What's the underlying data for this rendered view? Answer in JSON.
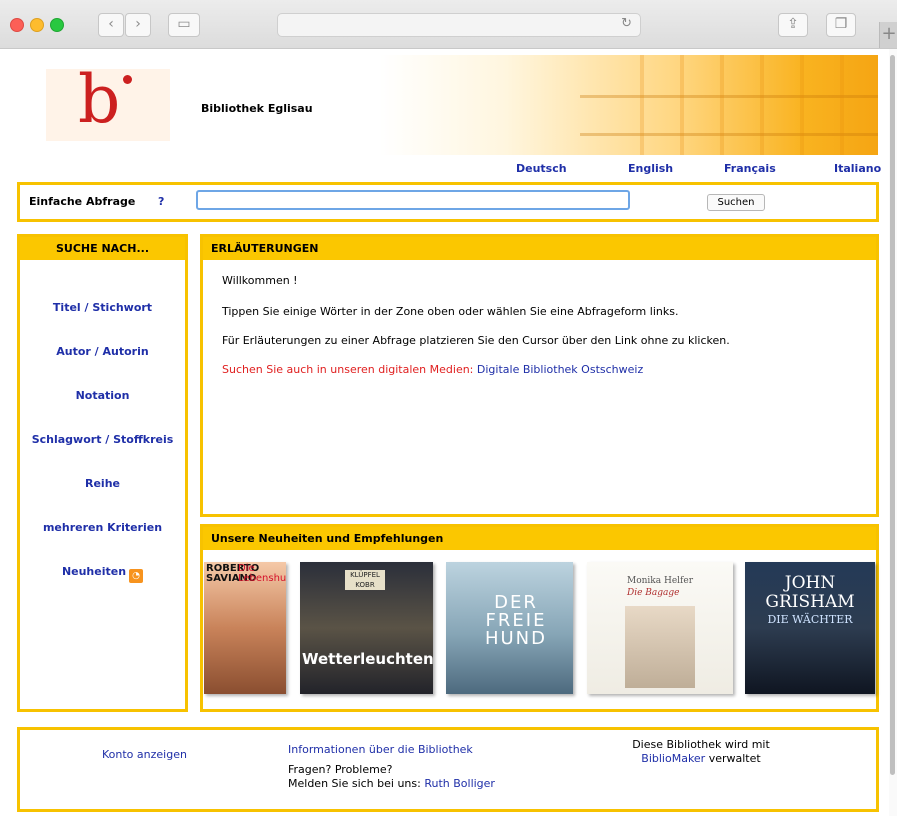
{
  "library": {
    "name": "Bibliothek Eglisau",
    "logo_letter": "b"
  },
  "languages": [
    "Deutsch",
    "English",
    "Français",
    "Italiano"
  ],
  "simple_search": {
    "label": "Einfache Abfrage",
    "help": "?",
    "value": "",
    "button": "Suchen"
  },
  "sidebar": {
    "title": "SUCHE NACH...",
    "items": [
      "Titel / Stichwort",
      "Autor / Autorin",
      "Notation",
      "Schlagwort / Stoffkreis",
      "Reihe",
      "mehreren Kriterien",
      "Neuheiten"
    ]
  },
  "explanations": {
    "title": "ERLÄUTERUNGEN",
    "welcome": "Willkommen !",
    "line1": "Tippen Sie einige Wörter in der Zone oben oder wählen Sie eine Abfrageform links.",
    "line2": "Für Erläuterungen zu einer Abfrage platzieren Sie den Cursor über den Link ohne zu klicken.",
    "digital_prefix": "Suchen Sie auch in unseren digitalen Medien:",
    "digital_link": "Digitale Bibliothek Ostschweiz"
  },
  "news": {
    "title": "Unsere Neuheiten und Empfehlungen",
    "covers": [
      {
        "author": "ROBERTO SAVIANO",
        "title": "Die Lebenshungrigen"
      },
      {
        "author": "KLÜPFEL KOBR",
        "title": "Wetterleuchten"
      },
      {
        "title": "DER FREIE HUND"
      },
      {
        "author": "Monika Helfer",
        "title": "Die Bagage"
      },
      {
        "author": "JOHN GRISHAM",
        "title": "DIE WÄCHTER"
      }
    ]
  },
  "footer": {
    "account": "Konto anzeigen",
    "info": "Informationen über die Bibliothek",
    "questions": "Fragen? Probleme?",
    "contact_prefix": "Melden Sie sich bei uns:",
    "contact_name": "Ruth Bolliger",
    "managed_prefix": "Diese Bibliothek wird mit",
    "managed_link": "BiblioMaker",
    "managed_suffix": "verwaltet"
  },
  "colors": {
    "accent": "#f7c200",
    "link": "#1f2fa8",
    "notice": "#e02020",
    "logo": "#cc2020"
  }
}
